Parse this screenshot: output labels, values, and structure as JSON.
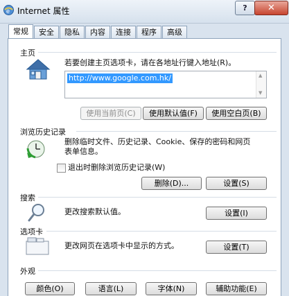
{
  "window": {
    "title": "Internet 属性",
    "help_label": "?",
    "close_label": "✕"
  },
  "tabs": [
    {
      "label": "常规",
      "active": true
    },
    {
      "label": "安全"
    },
    {
      "label": "隐私"
    },
    {
      "label": "内容"
    },
    {
      "label": "连接"
    },
    {
      "label": "程序"
    },
    {
      "label": "高级"
    }
  ],
  "homepage": {
    "title": "主页",
    "description": "若要创建主页选项卡，请在各地址行键入地址(R)。",
    "url_value": "http://www.google.com.hk/",
    "buttons": {
      "use_current": "使用当前页(C)",
      "use_default": "使用默认值(F)",
      "use_blank": "使用空白页(B)"
    }
  },
  "history": {
    "title": "浏览历史记录",
    "description_line1": "删除临时文件、历史记录、Cookie、保存的密码和网页",
    "description_line2": "表单信息。",
    "checkbox_label": "退出时删除浏览历史记录(W)",
    "delete_button": "删除(D)...",
    "settings_button": "设置(S)"
  },
  "search": {
    "title": "搜索",
    "description": "更改搜索默认值。",
    "settings_button": "设置(I)"
  },
  "tabs_section": {
    "title": "选项卡",
    "description": "更改网页在选项卡中显示的方式。",
    "settings_button": "设置(T)"
  },
  "appearance": {
    "title": "外观",
    "buttons": {
      "colors": "颜色(O)",
      "languages": "语言(L)",
      "fonts": "字体(N)",
      "accessibility": "辅助功能(E)"
    }
  }
}
